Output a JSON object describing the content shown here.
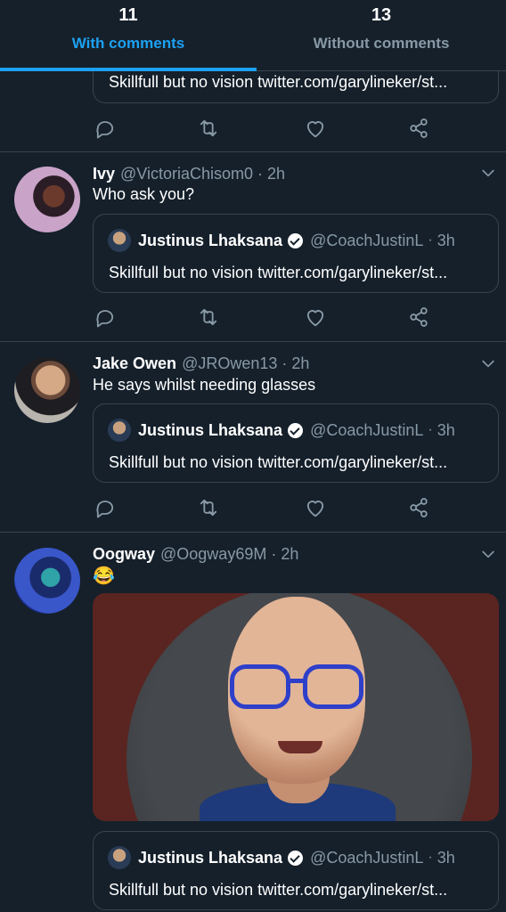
{
  "tabs": [
    {
      "count": "11",
      "label": "With comments"
    },
    {
      "count": "13",
      "label": "Without comments"
    }
  ],
  "quoted": {
    "name": "Justinus Lhaksana",
    "handle": "@CoachJustinL",
    "time": "3h",
    "text": "Skillfull but no vision twitter.com/garylineker/st..."
  },
  "tweets": [
    {
      "name": "Ivy",
      "handle": "@VictoriaChisom0",
      "time": "2h",
      "text": "Who ask you?"
    },
    {
      "name": "Jake Owen",
      "handle": "@JROwen13",
      "time": "2h",
      "text": "He says whilst needing glasses"
    },
    {
      "name": "Oogway",
      "handle": "@Oogway69M",
      "time": "2h",
      "text": "😂"
    }
  ],
  "separator": "·",
  "icons": {
    "reply": "reply-icon",
    "retweet": "retweet-icon",
    "like": "like-icon",
    "share": "share-icon",
    "more": "chevron-down-icon",
    "verified": "verified-badge-icon"
  },
  "colors": {
    "background": "#15202b",
    "accent": "#1da1f2",
    "muted": "#8899a6",
    "border": "#38444d"
  }
}
